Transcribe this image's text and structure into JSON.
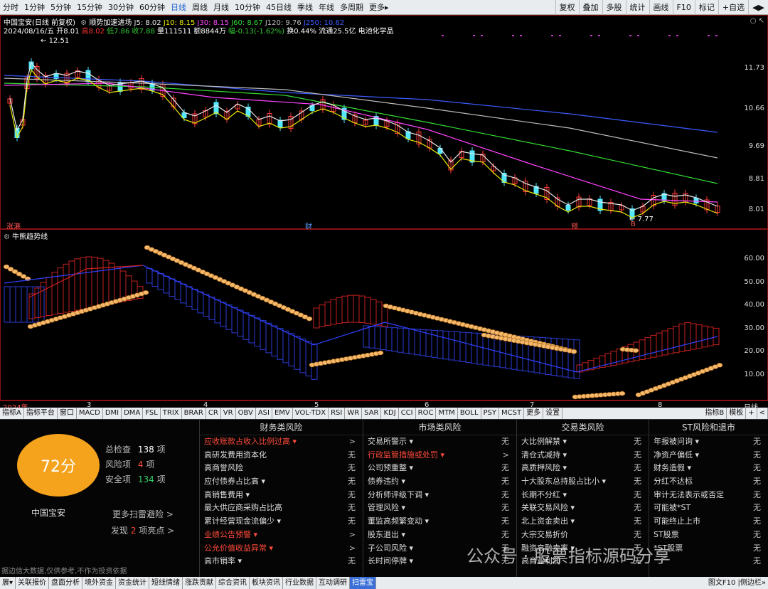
{
  "toolbar": {
    "periods": [
      "分时",
      "1分钟",
      "5分钟",
      "15分钟",
      "30分钟",
      "60分钟",
      "日线",
      "周线",
      "月线",
      "10分钟",
      "45日线",
      "季线",
      "年线",
      "多周期",
      "更多▸"
    ],
    "active_period": "日线",
    "right_buttons": [
      "复权",
      "叠加",
      "多股",
      "统计",
      "画线",
      "F10",
      "标记",
      "+自选",
      "◀▶"
    ]
  },
  "stock": {
    "title": "中国宝安(日线 前复权)",
    "indicator_name": "顺势加速进场",
    "ma_labels": [
      "J5: 8.02",
      "J10: 8.15",
      "J30: 8.15",
      "J60: 8.67",
      "J120: 9.76",
      "J250: 10.62"
    ],
    "ma_colors": [
      "#e8e8e8",
      "#e8e800",
      "#ff44ff",
      "#33dd33",
      "#bbbbbb",
      "#3b5bff"
    ],
    "date": "2024/08/16/五",
    "quote": [
      {
        "label": "开",
        "value": "8.01",
        "color": "#ffffff"
      },
      {
        "label": "高",
        "value": "8.02",
        "color": "#ff3333"
      },
      {
        "label": "低",
        "value": "7.86",
        "color": "#33cc33"
      },
      {
        "label": "收",
        "value": "7.88",
        "color": "#33cc33"
      },
      {
        "label": "量",
        "value": "111511",
        "color": "#ffffff"
      },
      {
        "label": "额",
        "value": "8844万",
        "color": "#ffffff"
      },
      {
        "label": "幅",
        "value": "-0.13(-1.62%)",
        "color": "#33cc33"
      },
      {
        "label": "换",
        "value": "0.44%",
        "color": "#ffffff"
      },
      {
        "label": "流通",
        "value": "25.5亿",
        "color": "#ffffff"
      },
      {
        "label": "",
        "value": "电池化学品",
        "color": "#ffffff"
      }
    ],
    "high_label": "12.51",
    "low_label": "7.77",
    "price_axis": [
      "11.73",
      "10.66",
      "9.69",
      "8.81",
      "8.01"
    ],
    "markers": [
      "涨港",
      "财",
      "预",
      "B"
    ]
  },
  "indicator": {
    "title": "牛熊趋势线",
    "axis": [
      "60.00",
      "50.00",
      "40.00",
      "30.00",
      "20.00",
      "10.00"
    ]
  },
  "date_axis": {
    "labels": [
      "2024年",
      "3",
      "4",
      "5",
      "6",
      "7",
      "8"
    ],
    "period": "日线"
  },
  "indicator_tabs": [
    "指标A",
    "指标平台",
    "窗口",
    "MACD",
    "DMI",
    "DMA",
    "FSL",
    "TRIX",
    "BRAR",
    "CR",
    "VR",
    "OBV",
    "ASI",
    "EMV",
    "VOL-TDX",
    "RSI",
    "WR",
    "SAR",
    "KDJ",
    "CCI",
    "ROC",
    "MTM",
    "BOLL",
    "PSY",
    "MCST",
    "更多",
    "设置"
  ],
  "indicator_tabs_right": [
    "指标B",
    "模板",
    "+",
    "<"
  ],
  "risk": {
    "score": "72分",
    "stock_name": "中国宝安",
    "total_label": "总检查",
    "total_value": "138",
    "total_unit": "项",
    "risk_label": "风险项",
    "risk_value": "4",
    "risk_unit": "项",
    "safe_label": "安全项",
    "safe_value": "134",
    "safe_unit": "项",
    "more_link": "更多扫雷避险 >",
    "find_prefix": "发现",
    "find_value": "2",
    "find_suffix": "项亮点 >",
    "columns": [
      {
        "title": "财务类风险",
        "items": [
          {
            "name": "应收账款占收入比例过高 ▾",
            "status": ">",
            "warn": true
          },
          {
            "name": "高研发费用资本化",
            "status": "无",
            "warn": false
          },
          {
            "name": "高商誉风险",
            "status": "无",
            "warn": false
          },
          {
            "name": "应付债券占比高 ▾",
            "status": "无",
            "warn": false
          },
          {
            "name": "高销售费用 ▾",
            "status": "无",
            "warn": false
          },
          {
            "name": "最大供应商采购占比高",
            "status": "无",
            "warn": false
          },
          {
            "name": "累计经营现金流偏少 ▾",
            "status": "无",
            "warn": false
          },
          {
            "name": "业绩公告预警 ▾",
            "status": ">",
            "warn": true
          },
          {
            "name": "公允价值收益异常 ▾",
            "status": ">",
            "warn": true
          },
          {
            "name": "高市销率 ▾",
            "status": "无",
            "warn": false
          }
        ]
      },
      {
        "title": "市场类风险",
        "items": [
          {
            "name": "交易所警示 ▾",
            "status": "无",
            "warn": false
          },
          {
            "name": "行政监管措施或处罚 ▾",
            "status": ">",
            "warn": true
          },
          {
            "name": "公司预重整 ▾",
            "status": "无",
            "warn": false
          },
          {
            "name": "债券违约 ▾",
            "status": "无",
            "warn": false
          },
          {
            "name": "分析师评级下调 ▾",
            "status": "无",
            "warn": false
          },
          {
            "name": "管理风险 ▾",
            "status": "无",
            "warn": false
          },
          {
            "name": "董监高频繁变动 ▾",
            "status": "无",
            "warn": false
          },
          {
            "name": "股东退出 ▾",
            "status": "无",
            "warn": false
          },
          {
            "name": "子公司风险 ▾",
            "status": "无",
            "warn": false
          },
          {
            "name": "长时间停牌 ▾",
            "status": "无",
            "warn": false
          }
        ]
      },
      {
        "title": "交易类风险",
        "items": [
          {
            "name": "大比例解禁 ▾",
            "status": "无",
            "warn": false
          },
          {
            "name": "清仓式减持 ▾",
            "status": "无",
            "warn": false
          },
          {
            "name": "高质押风险 ▾",
            "status": "无",
            "warn": false
          },
          {
            "name": "十大股东总持股占比小 ▾",
            "status": "无",
            "warn": false
          },
          {
            "name": "长期不分红 ▾",
            "status": "无",
            "warn": false
          },
          {
            "name": "关联交易风险 ▾",
            "status": "无",
            "warn": false
          },
          {
            "name": "北上资金卖出 ▾",
            "status": "无",
            "warn": false
          },
          {
            "name": "大宗交易折价",
            "status": "无",
            "warn": false
          },
          {
            "name": "融资高融卖率 ▾",
            "status": "无",
            "warn": false
          },
          {
            "name": "高商业利润",
            "status": "无",
            "warn": false
          }
        ]
      },
      {
        "title": "ST风险和退市",
        "items": [
          {
            "name": "年报被问询 ▾",
            "status": "无",
            "warn": false
          },
          {
            "name": "净资产偏低 ▾",
            "status": "无",
            "warn": false
          },
          {
            "name": "财务造假 ▾",
            "status": "无",
            "warn": false
          },
          {
            "name": "分红不达标",
            "status": "无",
            "warn": false
          },
          {
            "name": "审计无法表示或否定",
            "status": "无",
            "warn": false
          },
          {
            "name": "可能被*ST",
            "status": "无",
            "warn": false
          },
          {
            "name": "可能终止上市",
            "status": "无",
            "warn": false
          },
          {
            "name": "ST股票",
            "status": "无",
            "warn": false
          },
          {
            "name": "*ST股票",
            "status": "无",
            "warn": false
          },
          {
            "name": "",
            "status": "无",
            "warn": false
          }
        ]
      }
    ],
    "disclaimer": "据边信大数据,仅供参考,不作为投资依据"
  },
  "watermark": "公众号 · 股票指标源码分享",
  "footer": {
    "tabs": [
      "展▾",
      "关联报价",
      "盘面分析",
      "境外资金",
      "资金统计",
      "短线情绪",
      "涨跌贡献",
      "综合资讯",
      "板块资讯",
      "行业数据",
      "互动调研",
      "扫雷宝"
    ],
    "selected": "扫雷宝",
    "right": "图文F10 |侧边栏»"
  }
}
